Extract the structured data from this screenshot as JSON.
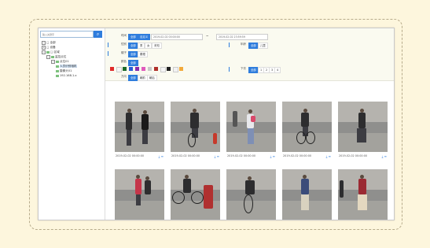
{
  "sidebar": {
    "search_placeholder": "输入关键字",
    "search_icon": "search-icon",
    "tree": [
      {
        "label": "□ 全部",
        "level": 0
      },
      {
        "label": "□ 设备",
        "level": 0
      },
      {
        "label": "□ 区域",
        "level": 0
      },
      {
        "label": "监控点位",
        "level": 1
      },
      {
        "label": "点位01",
        "level": 2
      },
      {
        "label": "人员识别相机",
        "level": 3
      },
      {
        "label": "摄像头01",
        "level": 3
      },
      {
        "label": "192.168.1.x",
        "level": 3
      }
    ]
  },
  "filters": {
    "row1": {
      "label": "时间",
      "chips": [
        "全部",
        "自定义"
      ],
      "active": 1,
      "start": "2019-02-02 00:00:00",
      "sep": "~",
      "end": "2019-02-02 23:59:59"
    },
    "row2": {
      "label": "性别",
      "chips": [
        "全部",
        "男",
        "女",
        "未知"
      ],
      "active": 0,
      "right_label": "年龄",
      "right_chips": [
        "全部",
        "儿童"
      ],
      "right_active": 0
    },
    "row3": {
      "label": "帽子",
      "chips": [
        "全部",
        "戴帽",
        "无帽"
      ],
      "active": 0
    },
    "row4": {
      "label": "颜色",
      "chips": [
        "全部"
      ],
      "active": 0
    },
    "row5": {
      "label": "上衣",
      "right_label": "下衣",
      "right_chips": [
        "全部",
        "1",
        "2",
        "3",
        "4"
      ],
      "right_active": 0
    },
    "row6": {
      "label": "方向",
      "chips": [
        "全部",
        "朝前",
        "朝后"
      ],
      "active": 0
    },
    "colors": [
      "#e02a2a",
      "#f5f5f5",
      "#1b6a2a",
      "#2a5bd7",
      "#8b2aa8",
      "#e05abd",
      "#c9c9c9",
      "#b0302a",
      "#f5f5f5",
      "#222222",
      "#f2f2f2",
      "#f2a93b"
    ]
  },
  "results": [
    {
      "time": "2019-02-02 00:00:00",
      "download_icon": "download-icon",
      "more_icon": "more-icon"
    },
    {
      "time": "2019-02-02 00:00:00",
      "download_icon": "download-icon",
      "more_icon": "more-icon"
    },
    {
      "time": "2019-02-02 00:00:00",
      "download_icon": "download-icon",
      "more_icon": "more-icon"
    },
    {
      "time": "2019-02-02 00:00:00",
      "download_icon": "download-icon",
      "more_icon": "more-icon"
    },
    {
      "time": "2019-02-02 00:00:00",
      "download_icon": "download-icon",
      "more_icon": "more-icon"
    },
    {
      "time": "",
      "download_icon": "download-icon",
      "more_icon": "more-icon"
    },
    {
      "time": "",
      "download_icon": "download-icon",
      "more_icon": "more-icon"
    },
    {
      "time": "",
      "download_icon": "download-icon",
      "more_icon": "more-icon"
    },
    {
      "time": "",
      "download_icon": "download-icon",
      "more_icon": "more-icon"
    },
    {
      "time": "",
      "download_icon": "download-icon",
      "more_icon": "more-icon"
    }
  ],
  "accent": "#2f7ddd"
}
